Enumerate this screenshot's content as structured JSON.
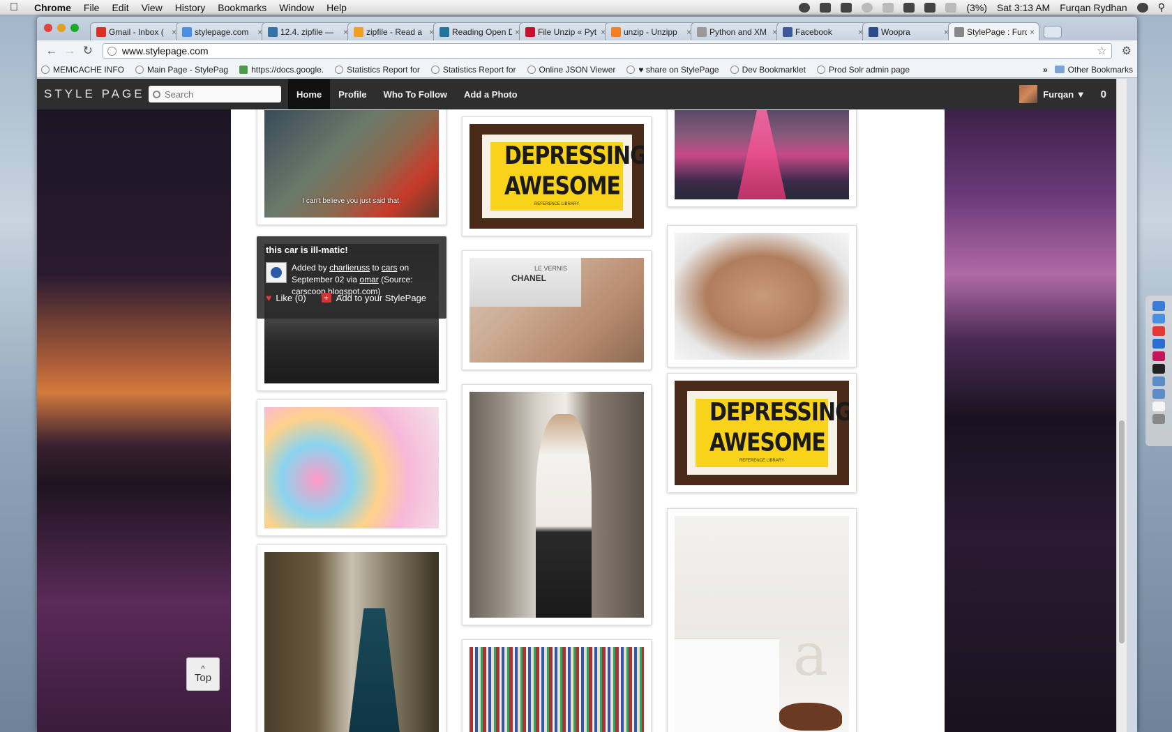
{
  "menubar": {
    "app": "Chrome",
    "menus": [
      "File",
      "Edit",
      "View",
      "History",
      "Bookmarks",
      "Window",
      "Help"
    ],
    "battery": "(3%)",
    "clock": "Sat 3:13 AM",
    "user": "Furqan Rydhan"
  },
  "tabs": [
    {
      "label": "Gmail - Inbox (",
      "icon": "gmail-icon",
      "color": "#d93025"
    },
    {
      "label": "stylepage.com",
      "icon": "loading-icon",
      "color": "#4a90e2"
    },
    {
      "label": "12.4. zipfile —",
      "icon": "python-icon",
      "color": "#3572a5"
    },
    {
      "label": "zipfile - Read a",
      "icon": "h-icon",
      "color": "#f0a020"
    },
    {
      "label": "Reading Open D",
      "icon": "wordpress-icon",
      "color": "#21759b"
    },
    {
      "label": "File Unzip « Pyt",
      "icon": "as-icon",
      "color": "#c8102e"
    },
    {
      "label": "unzip - Unzipp",
      "icon": "so-icon",
      "color": "#f48024"
    },
    {
      "label": "Python and XM",
      "icon": "page-icon",
      "color": "#999999"
    },
    {
      "label": "Facebook",
      "icon": "facebook-icon",
      "color": "#3b5998"
    },
    {
      "label": "Woopra",
      "icon": "woopra-icon",
      "color": "#2a4a8a"
    },
    {
      "label": "StylePage : Furq",
      "icon": "page-icon",
      "color": "#888888"
    }
  ],
  "toolbar": {
    "url": "www.stylepage.com"
  },
  "bookmarks": [
    {
      "label": "MEMCACHE INFO",
      "icon": "page-icon"
    },
    {
      "label": "Main Page - StylePag",
      "icon": "page-icon"
    },
    {
      "label": "https://docs.google.",
      "icon": "sheet-icon"
    },
    {
      "label": "Statistics Report for",
      "icon": "page-icon"
    },
    {
      "label": "Statistics Report for",
      "icon": "page-icon"
    },
    {
      "label": "Online JSON Viewer",
      "icon": "json-icon"
    },
    {
      "label": "♥ share on StylePage",
      "icon": "page-icon"
    },
    {
      "label": "Dev Bookmarklet",
      "icon": "page-icon"
    },
    {
      "label": "Prod Solr admin page",
      "icon": "solr-icon"
    }
  ],
  "bookmarks_other": "Other Bookmarks",
  "site": {
    "logo": "STYLE PAGE",
    "search_placeholder": "Search",
    "nav": [
      "Home",
      "Profile",
      "Who To Follow",
      "Add a Photo"
    ],
    "active_nav": "Home",
    "user": "Furqan ▼",
    "notifications": "0"
  },
  "cards": [
    {
      "id": "flight",
      "caption": "I can't believe you just said that."
    },
    {
      "id": "sign1",
      "sign_text": "DEPRESSINGLY AWESOME",
      "sign_small": "REFERENCE LIBRARY"
    },
    {
      "id": "vegas"
    },
    {
      "id": "car"
    },
    {
      "id": "nails",
      "brand": "CHANEL",
      "label": "LE VERNIS"
    },
    {
      "id": "bag"
    },
    {
      "id": "candy"
    },
    {
      "id": "fashion"
    },
    {
      "id": "sign2",
      "sign_text": "DEPRESSINGLY AWESOME",
      "sign_small": "REFERENCE LIBRARY"
    },
    {
      "id": "lady"
    },
    {
      "id": "books"
    },
    {
      "id": "bedroom"
    }
  ],
  "overlay": {
    "title": "this car is ill-matic!",
    "added_by": "Added by",
    "user": "charlieruss",
    "to": "to",
    "board": "cars",
    "on": "on",
    "date": "September 02 via",
    "via": "omar",
    "source": "(Source: carscoop.blogspot.com)",
    "like": "Like (0)",
    "add": "Add to your StylePage"
  },
  "top_button": "Top"
}
